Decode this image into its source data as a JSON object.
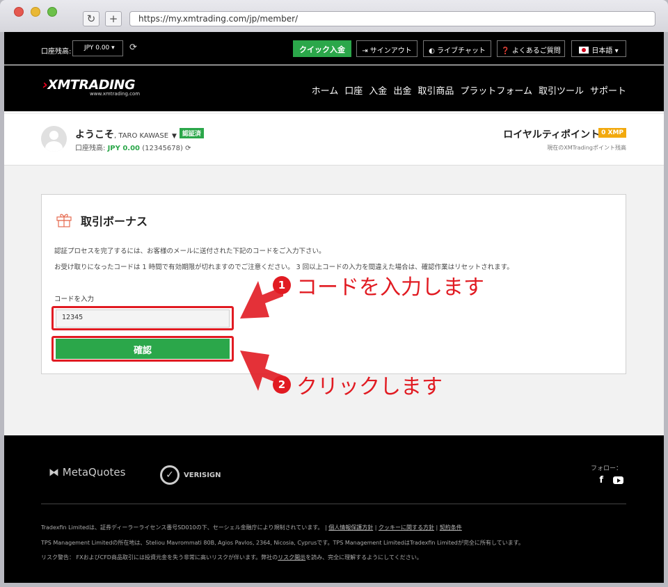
{
  "browser": {
    "url": "https://my.xmtrading.com/jp/member/",
    "reload_icon": "↻",
    "newtab_icon": "+"
  },
  "topbar": {
    "balance_label": "口座残高:",
    "balance_select": "JPY 0.00",
    "quick_deposit": "クイック入金",
    "signout": "サインアウト",
    "livechat": "ライブチャット",
    "faq": "よくあるご質問",
    "language": "日本語"
  },
  "nav": {
    "logo": "XMTRADING",
    "logo_sub": "www.xmtrading.com",
    "items": [
      "ホーム",
      "口座",
      "入金",
      "出金",
      "取引商品",
      "プラットフォーム",
      "取引ツール",
      "サポート"
    ]
  },
  "welcome": {
    "greeting": "ようこそ",
    "name": ", TARO KAWASE",
    "verified": "認証済",
    "balance_label": "口座残高:",
    "balance_amount": "JPY 0.00",
    "account_number": "(12345678)",
    "loyalty_title": "ロイヤルティポイント",
    "loyalty_points": "0 XMP",
    "loyalty_sub": "現在のXMTradingポイント残高"
  },
  "bonus": {
    "title": "取引ボーナス",
    "desc1": "認証プロセスを完了するには、お客様のメールに送付された下記のコードをご入力下さい。",
    "desc2": "お受け取りになったコードは 1 時間で有効期限が切れますのでご注意ください。 3 回以上コードの入力を間違えた場合は、確認作業はリセットされます。",
    "code_label": "コードを入力",
    "code_value": "12345",
    "confirm_button": "確認"
  },
  "annotations": {
    "step1_num": "1",
    "step1_text": "コードを入力します",
    "step2_num": "2",
    "step2_text": "クリックします",
    "color": "#e11b22"
  },
  "footer": {
    "metaquotes": "MetaQuotes",
    "verisign": "VERISIGN",
    "follow": "フォロー：",
    "line1_text": "Tradexfin Limitedは、証券ディーラーライセンス番号SD010の下、セーシェル金融庁により規制されています。 |",
    "line1_link1": "個人情報保護方針",
    "line1_link2": "クッキーに関する方針",
    "line1_link3": "契約条件",
    "line2": "TPS Management Limitedの所在地は、Steliou Mavrommati 80B, Agios Pavlos, 2364, Nicosia, Cyprusです。TPS Management LimitedはTradexfin Limitedが完全に所有しています。",
    "line3_pre": "リスク警告： FXおよびCFD商品取引には投資元金を失う非常に高いリスクが伴います。弊社の",
    "line3_link": "リスク開示",
    "line3_post": "を読み、完全に理解するようにしてください。"
  },
  "colors": {
    "green": "#2ba74a",
    "red": "#e11b22",
    "orange": "#f2a90e",
    "black": "#000000"
  }
}
